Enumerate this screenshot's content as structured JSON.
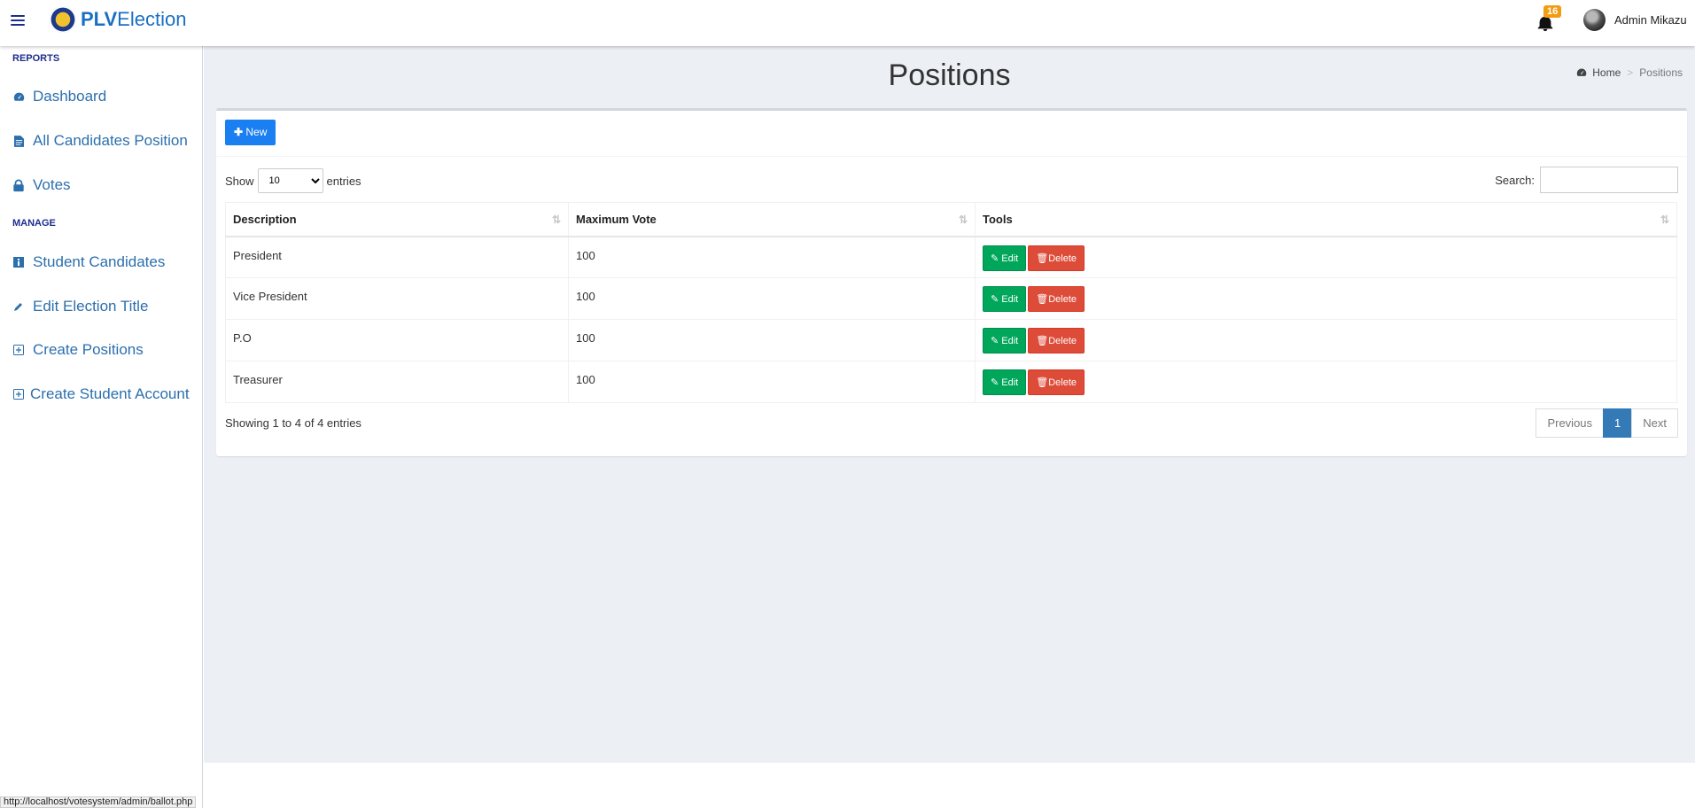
{
  "header": {
    "brand_bold": "PLV",
    "brand_rest": "Election",
    "notification_count": "16",
    "user_name": "Admin Mikazu"
  },
  "sidebar": {
    "reports_header": "REPORTS",
    "manage_header": "MANAGE",
    "reports_items": [
      {
        "label": "Dashboard",
        "icon": "dashboard-icon"
      },
      {
        "label": "All Candidates Position",
        "icon": "file-icon"
      },
      {
        "label": "Votes",
        "icon": "lock-icon"
      }
    ],
    "manage_items": [
      {
        "label": "Student Candidates",
        "icon": "info-icon"
      },
      {
        "label": "Edit Election Title",
        "icon": "pencil-icon"
      },
      {
        "label": "Create Positions",
        "icon": "plus-square-icon"
      },
      {
        "label": "Create Student Account",
        "icon": "plus-square-icon"
      }
    ]
  },
  "page": {
    "title": "Positions",
    "breadcrumb_home": "Home",
    "breadcrumb_current": "Positions"
  },
  "toolbar": {
    "new_label": "New"
  },
  "table_controls": {
    "show_label": "Show",
    "entries_label": "entries",
    "page_length": "10",
    "search_label": "Search:"
  },
  "table": {
    "headers": [
      "Description",
      "Maximum Vote",
      "Tools"
    ],
    "rows": [
      {
        "description": "President",
        "max_vote": "100"
      },
      {
        "description": "Vice President",
        "max_vote": "100"
      },
      {
        "description": "P.O",
        "max_vote": "100"
      },
      {
        "description": "Treasurer",
        "max_vote": "100"
      }
    ],
    "edit_label": "Edit",
    "delete_label": "Delete"
  },
  "footer": {
    "info": "Showing 1 to 4 of 4 entries",
    "previous": "Previous",
    "current_page": "1",
    "next": "Next"
  },
  "statusbar": {
    "url": "http://localhost/votesystem/admin/ballot.php"
  },
  "colors": {
    "brand": "#1a6fc4",
    "new_button": "#1a7ff0",
    "edit_button": "#00a65a",
    "delete_button": "#dd4b39",
    "pager_active": "#337ab7",
    "content_bg": "#ecf0f5"
  }
}
